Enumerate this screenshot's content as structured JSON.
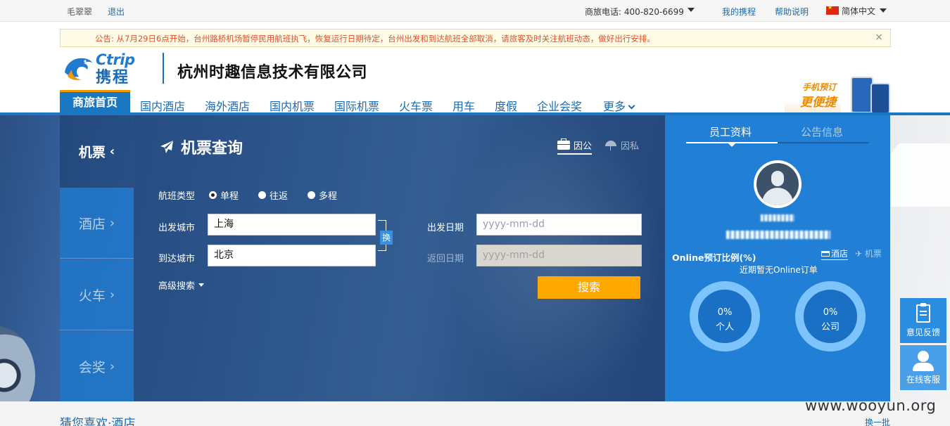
{
  "topbar": {
    "username": "毛翠翠",
    "logout": "退出",
    "phone": "商旅电话: 400-820-6699",
    "my_trip": "我的携程",
    "help": "帮助说明",
    "language": "简体中文"
  },
  "notice": {
    "text": "公告: 从7月29日6点开始，台州路桥机场暂停民用航班执飞，恢复运行日期待定，台州出发和到达航班全部取消，请旅客及时关注航班动态，做好出行安排。",
    "close": "×"
  },
  "header": {
    "logo_en": "Ctrip",
    "logo_cn": "携程",
    "company": "杭州时趣信息技术有限公司",
    "promo_line1": "手机预订",
    "promo_line2": "更便捷"
  },
  "nav": {
    "home": "商旅首页",
    "items": [
      "国内酒店",
      "海外酒店",
      "国内机票",
      "国际机票",
      "火车票",
      "用车",
      "度假",
      "企业会奖",
      "更多"
    ]
  },
  "side_tabs": [
    {
      "label": "机票",
      "arrow": "‹"
    },
    {
      "label": "酒店",
      "arrow": "›"
    },
    {
      "label": "火车",
      "arrow": "›"
    },
    {
      "label": "会奖",
      "arrow": "›"
    }
  ],
  "search": {
    "title": "机票查询",
    "tab_business": "因公",
    "tab_private": "因私",
    "flight_type_label": "航班类型",
    "options": [
      "单程",
      "往返",
      "多程"
    ],
    "selected_option": "单程",
    "from_label": "出发城市",
    "from_value": "上海",
    "to_label": "到达城市",
    "to_value": "北京",
    "swap": "换",
    "depart_label": "出发日期",
    "depart_placeholder": "yyyy-mm-dd",
    "return_label": "返回日期",
    "return_placeholder": "yyyy-mm-dd",
    "advanced": "高级搜索",
    "submit": "搜索"
  },
  "info": {
    "tab_profile": "员工资料",
    "tab_notice": "公告信息",
    "online_title": "Online预订比例(%)",
    "hotel": "酒店",
    "flight": "机票",
    "note": "近期暂无Online订单",
    "personal_pct": "0%",
    "personal_label": "个人",
    "company_pct": "0%",
    "company_label": "公司"
  },
  "float": {
    "feedback": "意见反馈",
    "service": "在线客服"
  },
  "bottom": {
    "guess": "猜您喜欢·酒店",
    "change": "换一批"
  },
  "watermark": "www.wooyun.org",
  "colors": {
    "brand_blue": "#1a78c2",
    "accent_orange": "#ffa800",
    "notice_text": "#e0502a"
  }
}
